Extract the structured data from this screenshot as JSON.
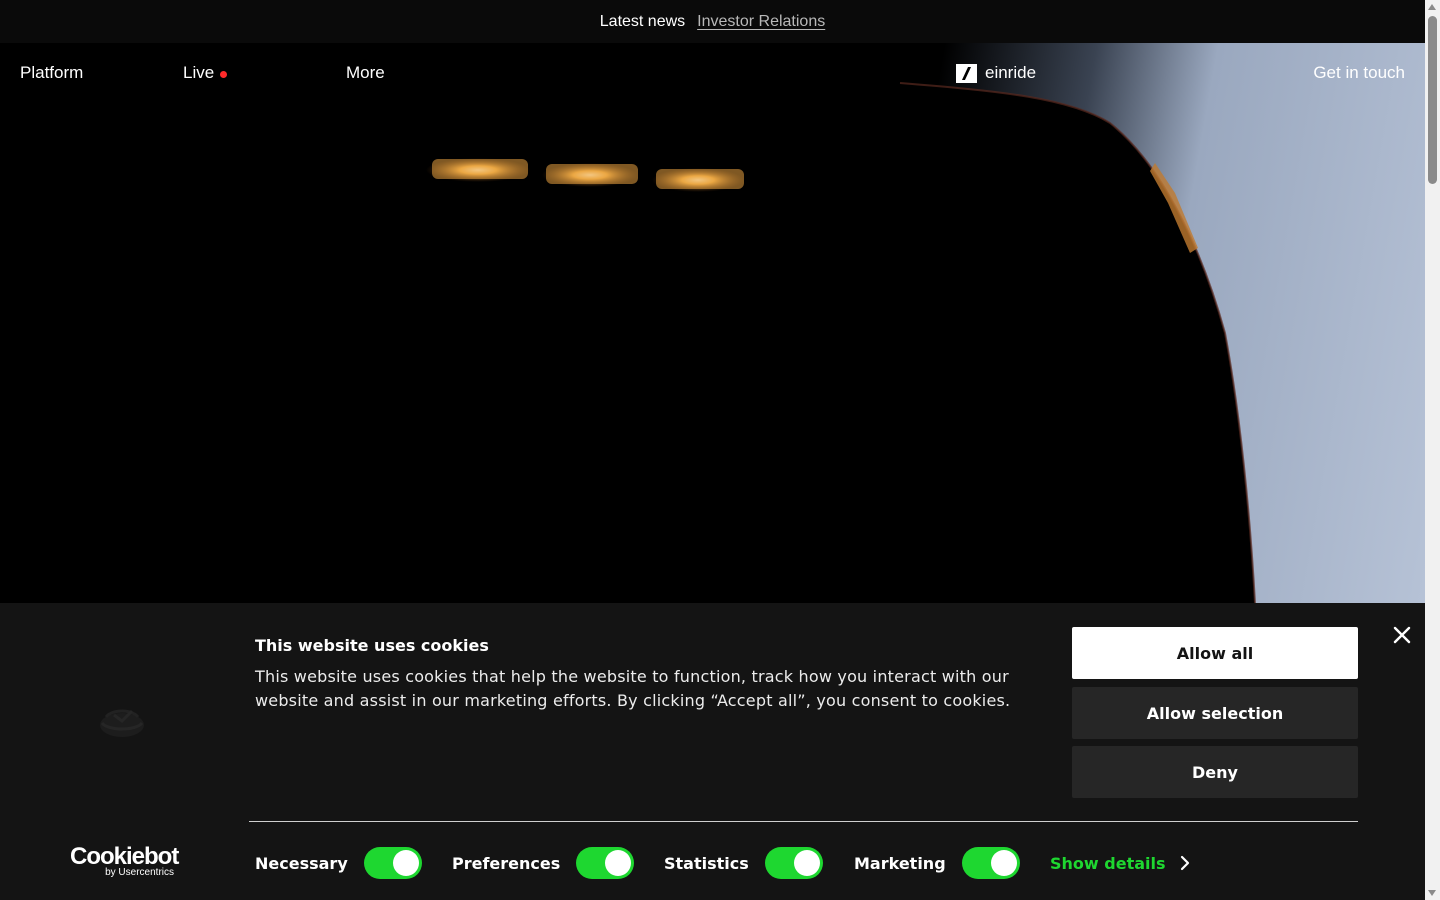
{
  "announcement": {
    "latest_news": "Latest news",
    "investor_relations": "Investor Relations"
  },
  "nav": {
    "platform": "Platform",
    "live": "Live",
    "more": "More",
    "logo_text": "einride",
    "get_in_touch": "Get in touch",
    "live_indicator_color": "#ff2a2a"
  },
  "cookie": {
    "title": "This website uses cookies",
    "body": "This website uses cookies that help the website to function, track how you interact with our website and assist in our marketing efforts. By clicking “Accept all”, you consent to cookies.",
    "allow_all": "Allow all",
    "allow_selection": "Allow selection",
    "deny": "Deny",
    "toggles": [
      {
        "label": "Necessary",
        "on": true
      },
      {
        "label": "Preferences",
        "on": true
      },
      {
        "label": "Statistics",
        "on": true
      },
      {
        "label": "Marketing",
        "on": true
      }
    ],
    "show_details": "Show details",
    "brand_name": "Cookiebot",
    "brand_by": "by Usercentrics",
    "accent_color": "#1ed730"
  }
}
